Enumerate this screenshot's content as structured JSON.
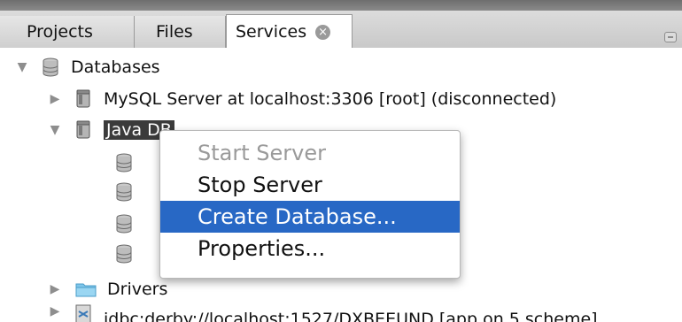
{
  "tabs": [
    {
      "label": "Projects"
    },
    {
      "label": "Files"
    },
    {
      "label": "Services",
      "close": "×"
    }
  ],
  "tree": {
    "databases_label": "Databases",
    "mysql_label": "MySQL Server at localhost:3306 [root] (disconnected)",
    "javadb_label": "Java DB",
    "drivers_label": "Drivers",
    "partial_row_text": "jdbc:derby://localhost:1527/DXBEEUND [app on 5 scheme]"
  },
  "context_menu": {
    "items": [
      {
        "label": "Start Server",
        "state": "disabled"
      },
      {
        "label": "Stop Server",
        "state": "enabled"
      },
      {
        "label": "Create Database...",
        "state": "highlighted"
      },
      {
        "label": "Properties...",
        "state": "enabled"
      }
    ]
  },
  "colors": {
    "highlight": "#2868c5",
    "selection": "#3b3b3b",
    "disabled_text": "#9a9a9a"
  }
}
